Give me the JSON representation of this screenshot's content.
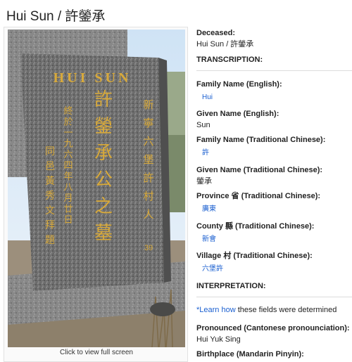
{
  "page": {
    "title": "Hui Sun / 許鎣承"
  },
  "photo": {
    "caption": "Click to view full screen",
    "stone_english": "HUI SUN",
    "stone_main": [
      "許",
      "鎣",
      "承",
      "公",
      "之",
      "墓"
    ],
    "stone_right": [
      "新",
      "寧",
      "六",
      "堡",
      "許",
      "村",
      "人"
    ],
    "stone_left_1": [
      "終",
      "於",
      "一",
      "九",
      "六",
      "四",
      "年",
      "八",
      "月",
      "廿",
      "日"
    ],
    "stone_left_2": [
      "同",
      "邑",
      "黃",
      "秀",
      "文",
      "拜",
      "題"
    ],
    "stone_age": "39"
  },
  "details": {
    "deceased_label": "Deceased:",
    "deceased_value": "Hui Sun / 許鎣承",
    "transcription_heading": "TRANSCRIPTION:",
    "family_en_label": "Family Name (English):",
    "family_en_value": "Hui",
    "given_en_label": "Given Name (English):",
    "given_en_value": "Sun",
    "family_tc_label": "Family Name (Traditional Chinese):",
    "family_tc_value": "許",
    "given_tc_label": "Given Name (Traditional Chinese):",
    "given_tc_value": "鎣承",
    "province_label": "Province 省 (Traditional Chinese):",
    "province_value": "廣東",
    "county_label": "County 縣 (Traditional Chinese):",
    "county_value": "新會",
    "village_label": "Village 村 (Traditional Chinese):",
    "village_value": "六堡許",
    "interpretation_heading": "INTERPRETATION:",
    "learn_link": "*Learn how",
    "learn_rest": " these fields were determined",
    "pronounced_label": "Pronounced (Cantonese pronounciation):",
    "pronounced_value": "Hui Yuk Sing",
    "birthplace_label": "Birthplace (Mandarin Pinyin):"
  }
}
